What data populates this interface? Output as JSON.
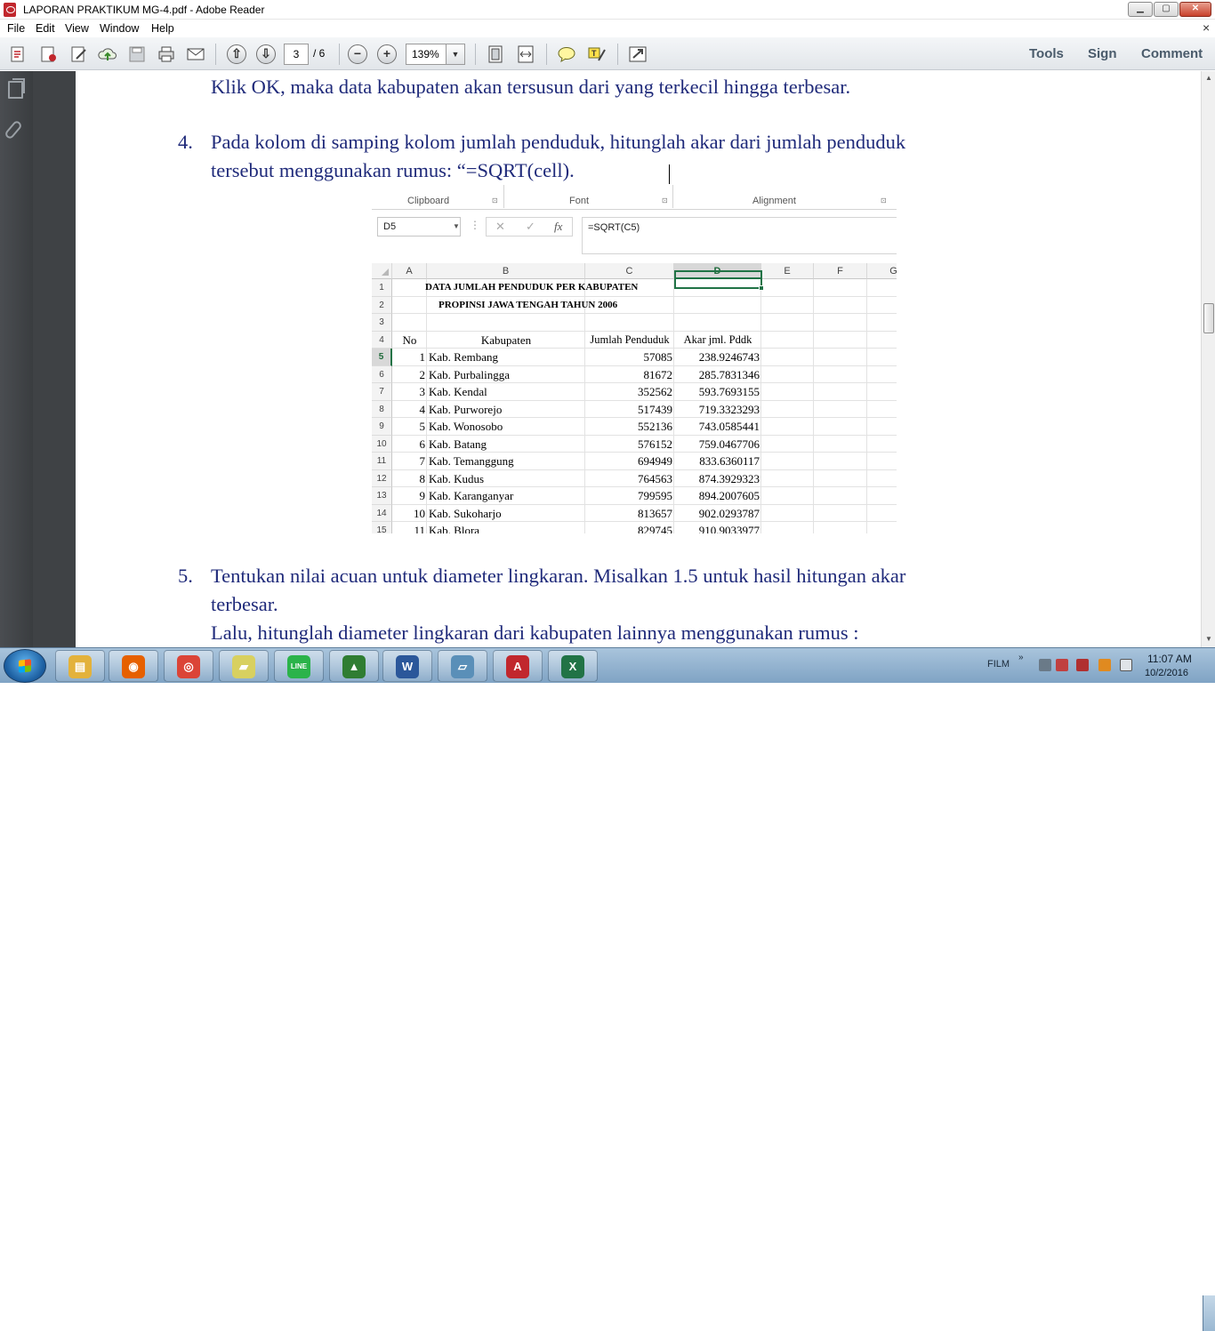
{
  "window": {
    "title": "LAPORAN PRAKTIKUM MG-4.pdf - Adobe Reader",
    "minimize": "▁",
    "maximize": "▢",
    "close": "✕"
  },
  "menu": {
    "items": [
      "File",
      "Edit",
      "View",
      "Window",
      "Help"
    ],
    "close_doc": "×"
  },
  "toolbar": {
    "page_current": "3",
    "page_total": "/ 6",
    "zoom": "139%",
    "zoom_out": "−",
    "zoom_in": "+",
    "prev_page": "⇧",
    "next_page": "⇩",
    "tools": "Tools",
    "sign": "Sign",
    "comment": "Comment",
    "icons": [
      "create-pdf-icon",
      "edit-pdf-icon",
      "sign-edit-icon",
      "upload-cloud-icon",
      "save-icon",
      "print-icon",
      "email-icon",
      "fit-page-icon",
      "fit-width-icon",
      "sticky-note-icon",
      "highlight-icon",
      "full-screen-icon"
    ]
  },
  "document": {
    "line1": "Klik OK, maka data kabupaten akan tersusun dari yang terkecil hingga terbesar.",
    "item4_num": "4.",
    "item4_line1": "Pada kolom di samping kolom jumlah penduduk, hitunglah akar dari jumlah penduduk",
    "item4_line2": "tersebut menggunakan rumus: “=SQRT(cell).",
    "item5_num": "5.",
    "item5_line1": "Tentukan nilai  acuan untuk diameter lingkaran. Misalkan 1.5 untuk hasil hitungan akar",
    "item5_line2": "terbesar.",
    "item5_line3": "Lalu, hitunglah diameter lingkaran dari kabupaten lainnya menggunakan rumus :"
  },
  "excel": {
    "ribbon": {
      "clipboard": "Clipboard",
      "font": "Font",
      "alignment": "Alignment",
      "launcher": "⊡"
    },
    "name_box": "D5",
    "name_box_arrow": "▼",
    "fx_dots": "⋮",
    "fx_cancel": "✕",
    "fx_enter": "✓",
    "fx_label": "fx",
    "formula": "=SQRT(C5)",
    "columns": [
      "A",
      "B",
      "C",
      "D",
      "E",
      "F",
      "G"
    ],
    "selected_column": "D",
    "selected_row": "5",
    "title1": "DATA JUMLAH PENDUDUK PER KABUPATEN",
    "title2": "PROPINSI JAWA TENGAH TAHUN 2006",
    "headers": {
      "no": "No",
      "kabupaten": "Kabupaten",
      "jumlah": "Jumlah Penduduk",
      "akar": "Akar jml. Pddk"
    },
    "row_numbers": [
      "1",
      "2",
      "3",
      "4",
      "5",
      "6",
      "7",
      "8",
      "9",
      "10",
      "11",
      "12",
      "13",
      "14",
      "15"
    ],
    "rows": [
      {
        "no": "1",
        "kab": "Kab. Rembang",
        "jumlah": "57085",
        "akar": "238.9246743"
      },
      {
        "no": "2",
        "kab": "Kab. Purbalingga",
        "jumlah": "81672",
        "akar": "285.7831346"
      },
      {
        "no": "3",
        "kab": "Kab. Kendal",
        "jumlah": "352562",
        "akar": "593.7693155"
      },
      {
        "no": "4",
        "kab": "Kab. Purworejo",
        "jumlah": "517439",
        "akar": "719.3323293"
      },
      {
        "no": "5",
        "kab": "Kab. Wonosobo",
        "jumlah": "552136",
        "akar": "743.0585441"
      },
      {
        "no": "6",
        "kab": "Kab. Batang",
        "jumlah": "576152",
        "akar": "759.0467706"
      },
      {
        "no": "7",
        "kab": "Kab. Temanggung",
        "jumlah": "694949",
        "akar": "833.6360117"
      },
      {
        "no": "8",
        "kab": "Kab. Kudus",
        "jumlah": "764563",
        "akar": "874.3929323"
      },
      {
        "no": "9",
        "kab": "Kab. Karanganyar",
        "jumlah": "799595",
        "akar": "894.2007605"
      },
      {
        "no": "10",
        "kab": "Kab. Sukoharjo",
        "jumlah": "813657",
        "akar": "902.0293787"
      },
      {
        "no": "11",
        "kab": "Kab. Blora",
        "jumlah": "829745",
        "akar": "910.9033977"
      }
    ]
  },
  "scrollbar": {
    "up": "▲",
    "down": "▼"
  },
  "taskbar": {
    "apps": [
      {
        "name": "file-explorer-icon",
        "glyph": "▤",
        "color": "#e3b23c"
      },
      {
        "name": "firefox-icon",
        "glyph": "◉",
        "color": "#e66000"
      },
      {
        "name": "chrome-icon",
        "glyph": "◎",
        "color": "#db4437"
      },
      {
        "name": "sticky-notes-icon",
        "glyph": "▰",
        "color": "#d8d060"
      },
      {
        "name": "line-app-icon",
        "glyph": "LINE",
        "color": "#2bb34a"
      },
      {
        "name": "archicad-icon",
        "glyph": "▲",
        "color": "#2f7d32"
      },
      {
        "name": "word-icon",
        "glyph": "W",
        "color": "#2b579a"
      },
      {
        "name": "notepad-icon",
        "glyph": "▱",
        "color": "#5a8fb8"
      },
      {
        "name": "adobe-reader-icon",
        "glyph": "A",
        "color": "#c1272d"
      },
      {
        "name": "excel-icon",
        "glyph": "X",
        "color": "#217346"
      }
    ],
    "tray_label": "FILM",
    "tray_chevron": "»",
    "time": "11:07 AM",
    "date": "10/2/2016"
  }
}
